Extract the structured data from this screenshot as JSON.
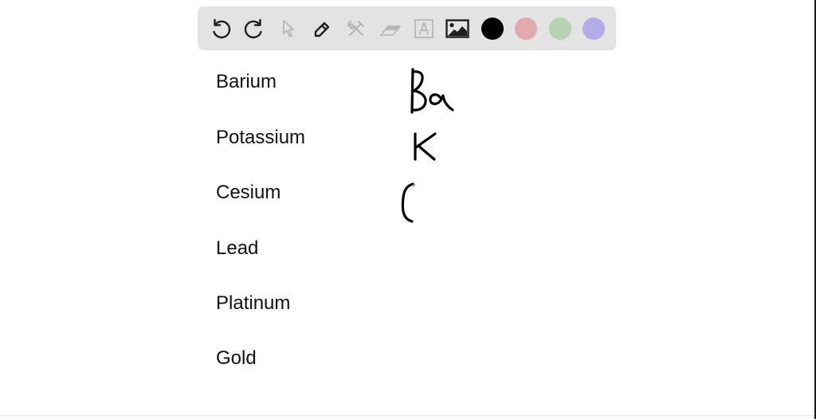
{
  "toolbar": {
    "tools": [
      {
        "id": "undo",
        "icon": "undo-icon",
        "label": "Undo",
        "enabled": true
      },
      {
        "id": "redo",
        "icon": "redo-icon",
        "label": "Redo",
        "enabled": true
      },
      {
        "id": "select",
        "icon": "pointer-icon",
        "label": "Select",
        "enabled": false
      },
      {
        "id": "pen",
        "icon": "pencil-icon",
        "label": "Pen",
        "enabled": true,
        "active": true
      },
      {
        "id": "tools",
        "icon": "tools-icon",
        "label": "Tools",
        "enabled": false
      },
      {
        "id": "eraser",
        "icon": "eraser-icon",
        "label": "Eraser",
        "enabled": false
      },
      {
        "id": "text",
        "icon": "text-box-icon",
        "label": "Text",
        "enabled": false
      },
      {
        "id": "image",
        "icon": "image-icon",
        "label": "Insert image",
        "enabled": true
      }
    ],
    "colors": [
      {
        "name": "black",
        "hex": "#000000",
        "selected": true
      },
      {
        "name": "pink",
        "hex": "#e2a9ad",
        "selected": false
      },
      {
        "name": "green",
        "hex": "#b5d3b1",
        "selected": false
      },
      {
        "name": "purple",
        "hex": "#b3ade6",
        "selected": false
      }
    ],
    "active_icon_color": "#1f1f1f",
    "disabled_icon_color": "#b5b5b5"
  },
  "elements": [
    {
      "name": "Barium",
      "handwritten_symbol": "Ba"
    },
    {
      "name": "Potassium",
      "handwritten_symbol": "K"
    },
    {
      "name": "Cesium",
      "handwritten_symbol": "C"
    },
    {
      "name": "Lead",
      "handwritten_symbol": ""
    },
    {
      "name": "Platinum",
      "handwritten_symbol": ""
    },
    {
      "name": "Gold",
      "handwritten_symbol": ""
    }
  ],
  "ink_color": "#000000"
}
